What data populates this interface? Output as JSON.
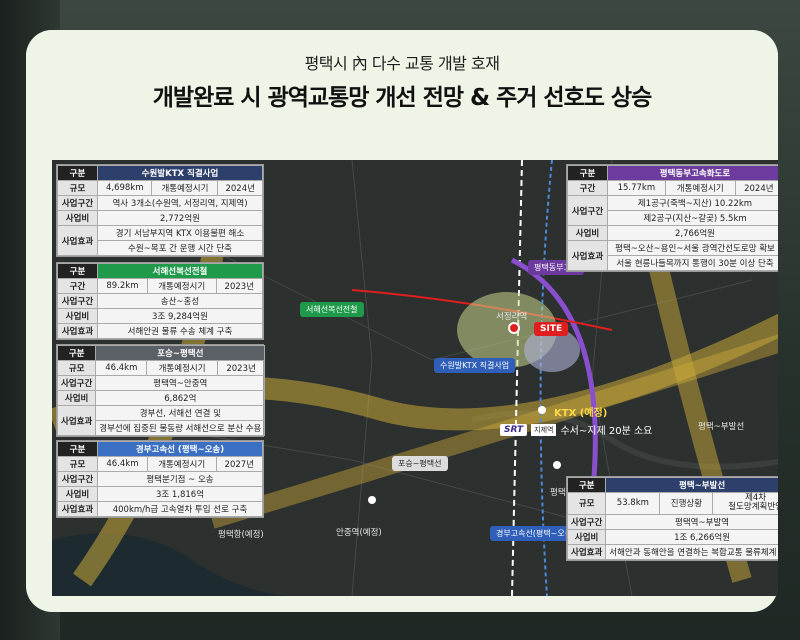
{
  "header": {
    "subtitle": "평택시 內 다수 교통 개발 호재",
    "title": "개발완료 시 광역교통망 개선 전망 & 주거 선호도 상승"
  },
  "boxes": {
    "suwon": {
      "head": [
        "구분",
        "수원발KTX 직결사업"
      ],
      "r1": [
        "규모",
        "4,698km",
        "개통예정시기",
        "2024년"
      ],
      "r2": [
        "사업구간",
        "역사 3개소(수원역, 서정리역, 지제역)"
      ],
      "r3": [
        "사업비",
        "2,772억원"
      ],
      "r4": [
        "사업효과",
        "경기 서남부지역 KTX 이용불편 해소",
        "수원~목포 간 운행 시간 단축"
      ]
    },
    "seohae": {
      "head": [
        "구분",
        "서해선복선전철"
      ],
      "r1": [
        "구간",
        "89.2km",
        "개통예정시기",
        "2023년"
      ],
      "r2": [
        "사업구간",
        "송산~홍성"
      ],
      "r3": [
        "사업비",
        "3조 9,284억원"
      ],
      "r4": [
        "사업효과",
        "서해안권 물류 수송 체계 구축"
      ]
    },
    "poseung": {
      "head": [
        "구분",
        "포승~평택선"
      ],
      "r1": [
        "규모",
        "46.4km",
        "개통예정시기",
        "2023년"
      ],
      "r2": [
        "사업구간",
        "평택역~안중역"
      ],
      "r3": [
        "사업비",
        "6,862억"
      ],
      "r4": [
        "사업효과",
        "경부선, 서해선 연결 및",
        "경부선에 집중된 물동량 서해선으로 분산 수용"
      ]
    },
    "gyeongbu": {
      "head": [
        "구분",
        "경부고속선 (평택~오송)"
      ],
      "r1": [
        "규모",
        "46.4km",
        "개통예정시기",
        "2027년"
      ],
      "r2": [
        "사업구간",
        "평택분기점 ~ 오송"
      ],
      "r3": [
        "사업비",
        "3조 1,816억"
      ],
      "r4": [
        "사업효과",
        "400km/h급 고속열차 투입 선로 구축"
      ]
    },
    "pyeongtaek_dongbu": {
      "head": [
        "구분",
        "평택동부고속화도로"
      ],
      "r1": [
        "구간",
        "15.77km",
        "개통예정시기",
        "2024년"
      ],
      "r2": [
        "사업구간",
        "제1공구(죽백~지산) 10.22km",
        "제2공구(지산~갈곶) 5.5km"
      ],
      "r3": [
        "사업비",
        "2,766억원"
      ],
      "r4": [
        "사업효과",
        "평택~오산~용인~서울 광역간선도로망 확보",
        "서울 현릉나들목까지 통행이 30분 이상 단축"
      ]
    },
    "pyeongtaek_bubal": {
      "head": [
        "구분",
        "평택~부발선"
      ],
      "r1": [
        "규모",
        "53.8km",
        "진행상황",
        "제4차",
        "철도망계획반영"
      ],
      "r2": [
        "사업구간",
        "평택역~부발역"
      ],
      "r3": [
        "사업비",
        "1조 6,266억원"
      ],
      "r4": [
        "사업효과",
        "서해안과 동해안을 연결하는 복합교통 물류체계 구축"
      ]
    }
  },
  "map_labels": {
    "seohae_line": "서해선복선전철",
    "suwon_ktx": "수원발KTX 직결사업",
    "dongbu": "평택동부고속",
    "site": "SITE",
    "seojeongni": "서정리역",
    "ktx": "KTX (예정)",
    "srt_logo": "SRT",
    "srt_box": "지제역",
    "srt_text": "수서~지제 20분 소요",
    "poseung_line": "포승~평택선",
    "bubal_line": "평택~부발선",
    "pyeongtaek_station": "평택역",
    "anjung": "안중역(예정)",
    "pyeongtaek_port": "평택항(예정)",
    "gyeongbu_line": "경부고속선(평택~오송)"
  }
}
